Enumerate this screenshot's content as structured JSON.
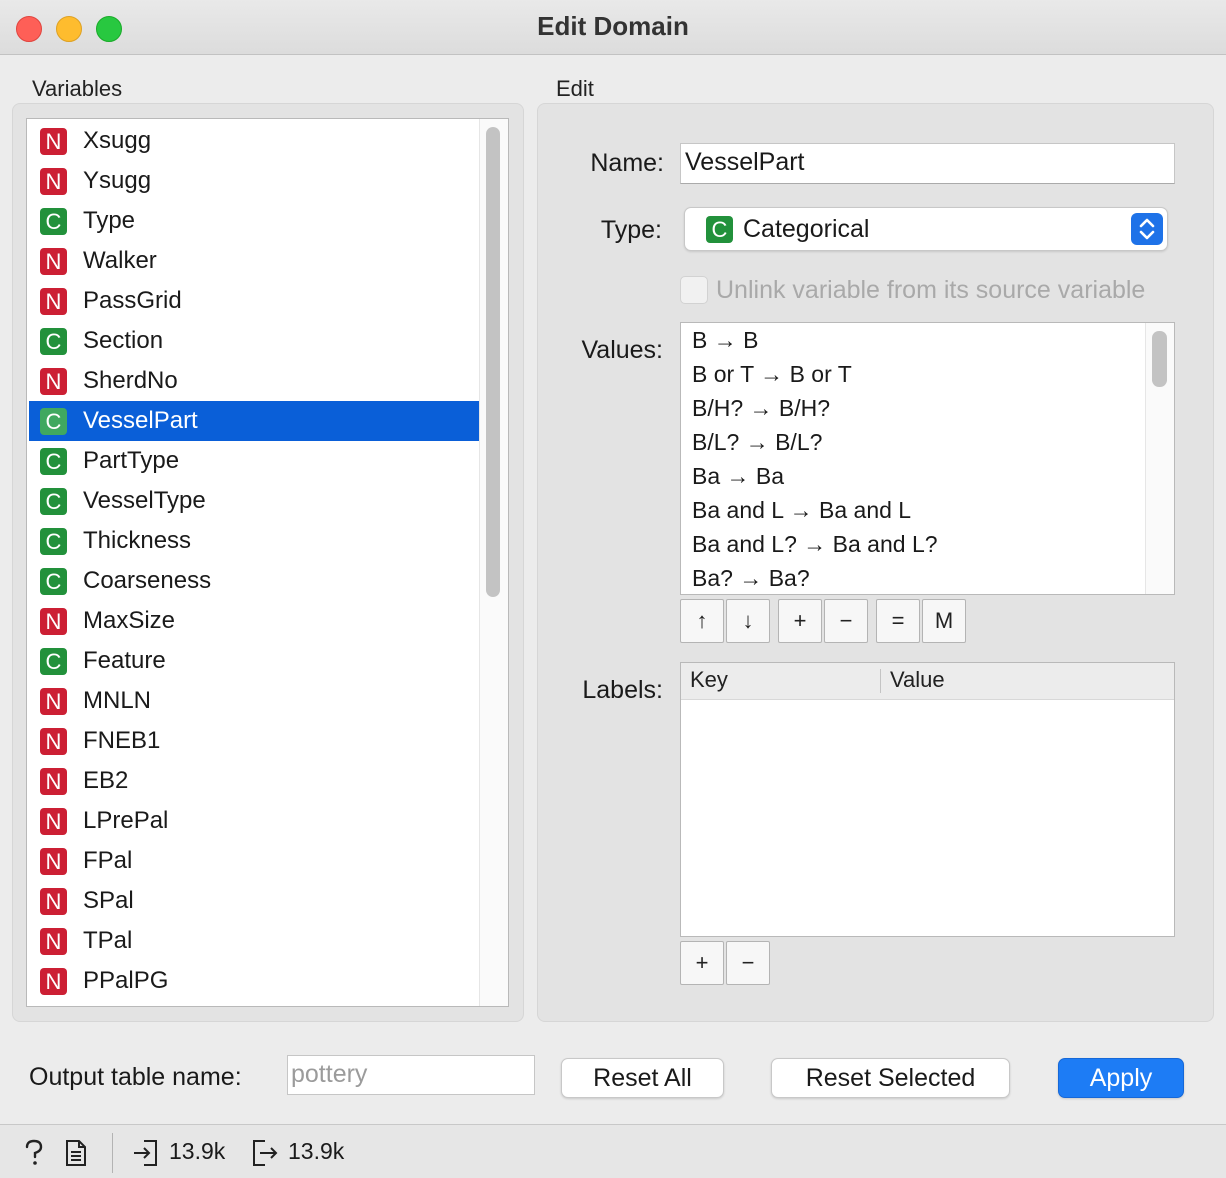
{
  "window": {
    "title": "Edit Domain"
  },
  "variables_panel": {
    "label": "Variables",
    "items": [
      {
        "type": "N",
        "name": "Xsugg"
      },
      {
        "type": "N",
        "name": "Ysugg"
      },
      {
        "type": "C",
        "name": "Type"
      },
      {
        "type": "N",
        "name": "Walker"
      },
      {
        "type": "N",
        "name": "PassGrid"
      },
      {
        "type": "C",
        "name": "Section"
      },
      {
        "type": "N",
        "name": "SherdNo"
      },
      {
        "type": "C",
        "name": "VesselPart",
        "selected": true
      },
      {
        "type": "C",
        "name": "PartType"
      },
      {
        "type": "C",
        "name": "VesselType"
      },
      {
        "type": "C",
        "name": "Thickness"
      },
      {
        "type": "C",
        "name": "Coarseness"
      },
      {
        "type": "N",
        "name": "MaxSize"
      },
      {
        "type": "C",
        "name": "Feature"
      },
      {
        "type": "N",
        "name": "MNLN"
      },
      {
        "type": "N",
        "name": "FNEB1"
      },
      {
        "type": "N",
        "name": "EB2"
      },
      {
        "type": "N",
        "name": "LPrePal"
      },
      {
        "type": "N",
        "name": "FPal"
      },
      {
        "type": "N",
        "name": "SPal"
      },
      {
        "type": "N",
        "name": "TPal"
      },
      {
        "type": "N",
        "name": "PPalPG"
      }
    ]
  },
  "edit_panel": {
    "label": "Edit",
    "name_label": "Name:",
    "name_value": "VesselPart",
    "type_label": "Type:",
    "type_badge": "C",
    "type_value": "Categorical",
    "unlink_label": "Unlink variable from its source variable",
    "values_label": "Values:",
    "values": [
      "B → B",
      "B or T → B or T",
      "B/H? → B/H?",
      "B/L? → B/L?",
      "Ba → Ba",
      "Ba and L → Ba and L",
      "Ba and L? → Ba and L?",
      "Ba? → Ba?"
    ],
    "value_buttons": [
      "↑",
      "↓",
      "+",
      "−",
      "=",
      "M"
    ],
    "labels_label": "Labels:",
    "labels_columns": [
      "Key",
      "Value"
    ],
    "labels_buttons": [
      "+",
      "−"
    ]
  },
  "footer": {
    "output_label": "Output table name:",
    "output_placeholder": "pottery",
    "reset_all": "Reset All",
    "reset_selected": "Reset Selected",
    "apply": "Apply"
  },
  "statusbar": {
    "input_size": "13.9k",
    "output_size": "13.9k"
  },
  "colors": {
    "numeric_badge": "#cc1f34",
    "categorical_badge": "#22913b",
    "selection": "#0a5fd8",
    "accent": "#1d7cf5"
  },
  "icons": [
    "help-icon",
    "report-icon",
    "input-data-icon",
    "output-data-icon",
    "updown-arrows-icon"
  ]
}
